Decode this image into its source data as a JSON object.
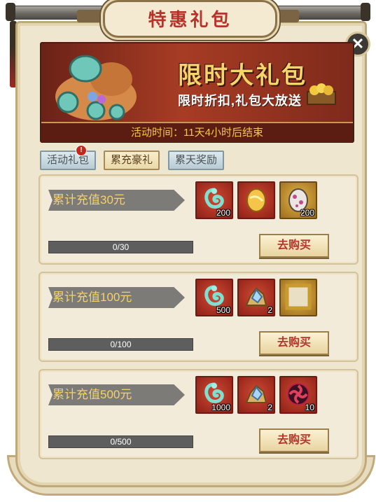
{
  "title": "特惠礼包",
  "banner": {
    "title": "限时大礼包",
    "subtitle": "限时折扣,礼包大放送",
    "time_label": "活动时间：11天4小时后结束"
  },
  "tabs": [
    {
      "label": "活动礼包",
      "active": false,
      "badge": "!"
    },
    {
      "label": "累充豪礼",
      "active": true
    },
    {
      "label": "累天奖励",
      "active": false
    }
  ],
  "buy_label": "去购买",
  "rewards": [
    {
      "label": "累计充值30元",
      "progress_text": "0/30",
      "progress_fraction": 0,
      "items": [
        {
          "icon": "jade-dragon-icon",
          "count": "200",
          "frame": "red"
        },
        {
          "icon": "golden-egg-icon",
          "count": "",
          "frame": "red"
        },
        {
          "icon": "spotted-egg-icon",
          "count": "200",
          "frame": "gold"
        }
      ]
    },
    {
      "label": "累计充值100元",
      "progress_text": "0/100",
      "progress_fraction": 0,
      "items": [
        {
          "icon": "jade-dragon-icon",
          "count": "500",
          "frame": "red"
        },
        {
          "icon": "crystal-ore-icon",
          "count": "2",
          "frame": "red"
        },
        {
          "icon": "gold-frame-icon",
          "count": "",
          "frame": "gold"
        }
      ]
    },
    {
      "label": "累计充值500元",
      "progress_text": "0/500",
      "progress_fraction": 0,
      "items": [
        {
          "icon": "jade-dragon-icon",
          "count": "1000",
          "frame": "red"
        },
        {
          "icon": "crystal-ore-icon",
          "count": "2",
          "frame": "red"
        },
        {
          "icon": "tomoe-emblem-icon",
          "count": "10",
          "frame": "red"
        }
      ]
    }
  ]
}
